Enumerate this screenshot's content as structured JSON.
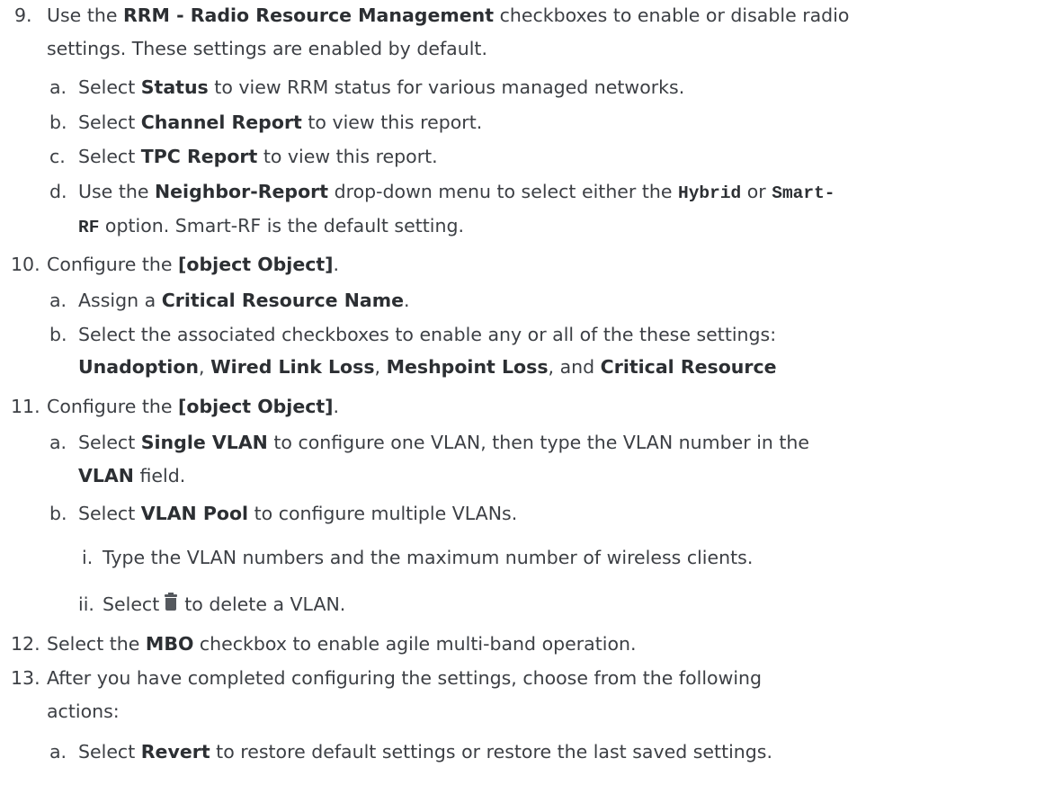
{
  "doc": {
    "s9": {
      "num": "9.",
      "l1_a": "Use the ",
      "l1_b": "RRM - Radio Resource Management",
      "l1_c": " checkboxes to enable or disable radio",
      "l2": "settings. These settings are enabled by default.",
      "a": {
        "lbl": "a.",
        "t1": "Select ",
        "b": "Status",
        "t2": " to view RRM status for various managed networks."
      },
      "b": {
        "lbl": "b.",
        "t1": "Select ",
        "b": "Channel Report",
        "t2": " to view this report."
      },
      "c": {
        "lbl": "c.",
        "t1": "Select ",
        "b": "TPC Report",
        "t2": " to view this report."
      },
      "d": {
        "lbl": "d.",
        "t1": "Use the ",
        "b": "Neighbor-Report",
        "t2": " drop-down menu to select either the ",
        "code1": "Hybrid",
        "t3": " or ",
        "code2a": "Smart-",
        "code2b": "RF",
        "t4": " option. Smart-RF is the default setting."
      }
    },
    "s10": {
      "num": "10.",
      "t1": "Configure the ",
      "b": {
        "lbl": "b.",
        "t1": "Select the associated checkboxes to enable any or all of the these settings:",
        "b1": "Unadoption",
        "sep1": ", ",
        "b2": "Wired Link Loss",
        "sep2": ", ",
        "b3": "Meshpoint Loss",
        "sep3": ", and ",
        "b4": "Critical Resource"
      },
      "t2": ".",
      "a": {
        "lbl": "a.",
        "t1": "Assign a ",
        "b": "Critical Resource Name",
        "t2": "."
      }
    },
    "s11": {
      "num": "11.",
      "t1": "Configure the ",
      "b": {
        "lbl": "b.",
        "t1": "Select ",
        "b": "VLAN Pool",
        "t2": " to configure multiple VLANs.",
        "i": {
          "lbl": "i.",
          "t": "Type the VLAN numbers and the maximum number of wireless clients."
        },
        "ii": {
          "lbl": "ii.",
          "t1": "Select",
          "icon": "trash-icon",
          "t2": "to delete a VLAN."
        }
      },
      "t2": ".",
      "a": {
        "lbl": "a.",
        "t1": "Select ",
        "b": "Single VLAN",
        "t2": " to configure one VLAN, then type the VLAN number in the",
        "b2": "VLAN",
        "t3": " field."
      }
    },
    "s12": {
      "num": "12.",
      "t1": "Select the ",
      "b": "MBO",
      "t2": " checkbox to enable agile multi-band operation."
    },
    "s13": {
      "num": "13.",
      "l1": "After you have completed configuring the settings, choose from the following",
      "l2": "actions:",
      "a": {
        "lbl": "a.",
        "t1": "Select ",
        "b": "Revert",
        "t2": " to restore default settings or restore the last saved settings."
      }
    }
  }
}
